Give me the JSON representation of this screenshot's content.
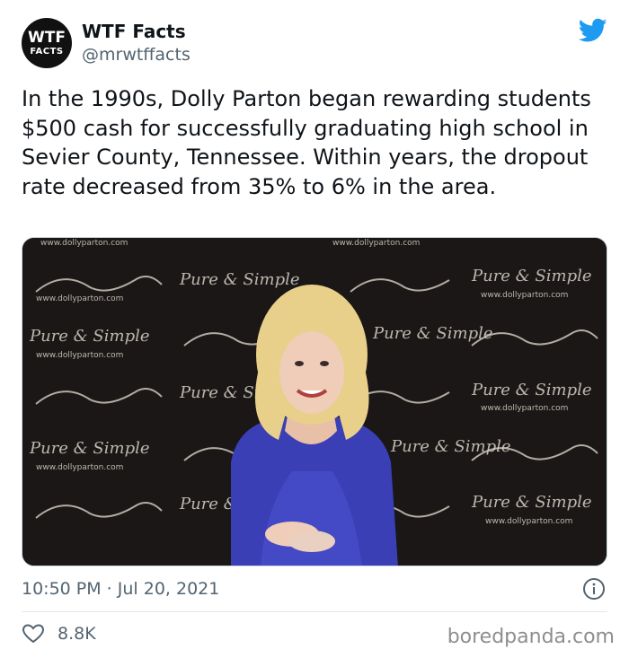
{
  "author": {
    "name": "WTF Facts",
    "handle": "@mrwtffacts",
    "avatar_line1": "WTF",
    "avatar_line2": "FACTS"
  },
  "tweet": {
    "text": "In the 1990s, Dolly Parton began rewarding students $500 cash for successfully graduating high school in Sevier County, Tennessee. Within years, the dropout rate decreased from 35% to 6% in the area.",
    "timestamp": "10:50 PM · Jul 20, 2021",
    "likes": "8.8K"
  },
  "media": {
    "backdrop_url": "www.dollyparton.com",
    "backdrop_brand": "Pure & Simple"
  },
  "watermark": "boredpanda.com",
  "colors": {
    "twitter_blue": "#1d9bf0",
    "secondary_text": "#536471",
    "backdrop": "#1a1716",
    "dress": "#3b3fb5",
    "hair": "#e8cf8a"
  },
  "icons": [
    "twitter-bird-icon",
    "info-icon",
    "heart-icon"
  ]
}
